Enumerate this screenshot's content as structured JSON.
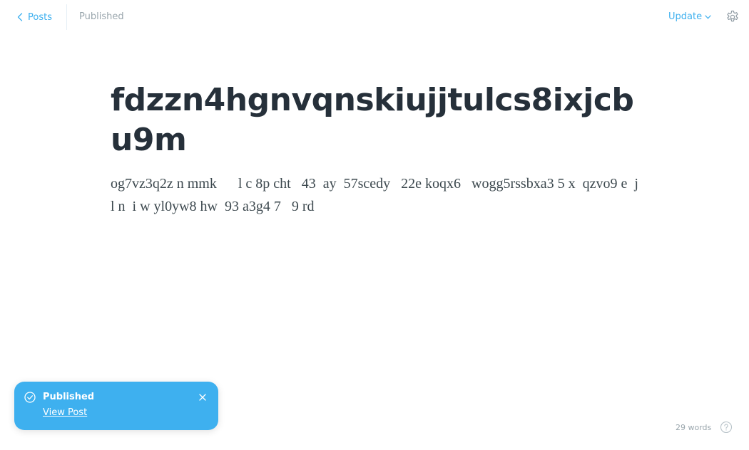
{
  "header": {
    "back_label": "Posts",
    "status": "Published",
    "update_label": "Update"
  },
  "editor": {
    "title": "fdzzn4hgnvqnskiujjtulcs8ixjcbu9m",
    "body": "og7vz3q2z n mmk      l c 8p cht   43  ay  57scedy   22e koqx6   wogg5rssbxa3 5 x  qzvo9 e  j l n  i w yl0yw8 hw  93 a3g4 7   9 rd"
  },
  "toast": {
    "title": "Published",
    "link_label": "View Post"
  },
  "footer": {
    "word_count": "29 words"
  },
  "icons": {
    "back": "chevron-left-icon",
    "update_dropdown": "chevron-down-icon",
    "settings": "gear-icon",
    "toast_status": "check-circle-icon",
    "toast_close": "close-icon",
    "help": "question-circle-icon"
  },
  "colors": {
    "accent": "#3eb0ef",
    "muted_text": "#9aa6ad",
    "title_text": "#26303a",
    "body_text": "#3c484e"
  }
}
